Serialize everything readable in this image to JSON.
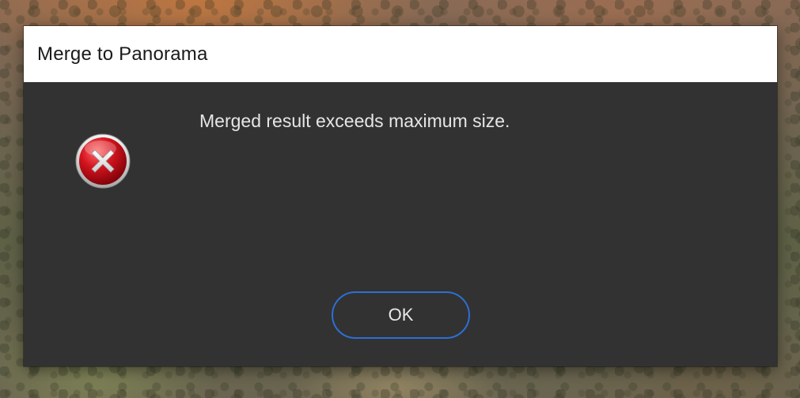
{
  "dialog": {
    "title": "Merge to Panorama",
    "message": "Merged result exceeds maximum size.",
    "icon": "error-icon",
    "ok_label": "OK"
  },
  "colors": {
    "dialog_background": "#323232",
    "titlebar_background": "#ffffff",
    "button_border": "#2d6fd6",
    "icon_red": "#c0141c"
  }
}
